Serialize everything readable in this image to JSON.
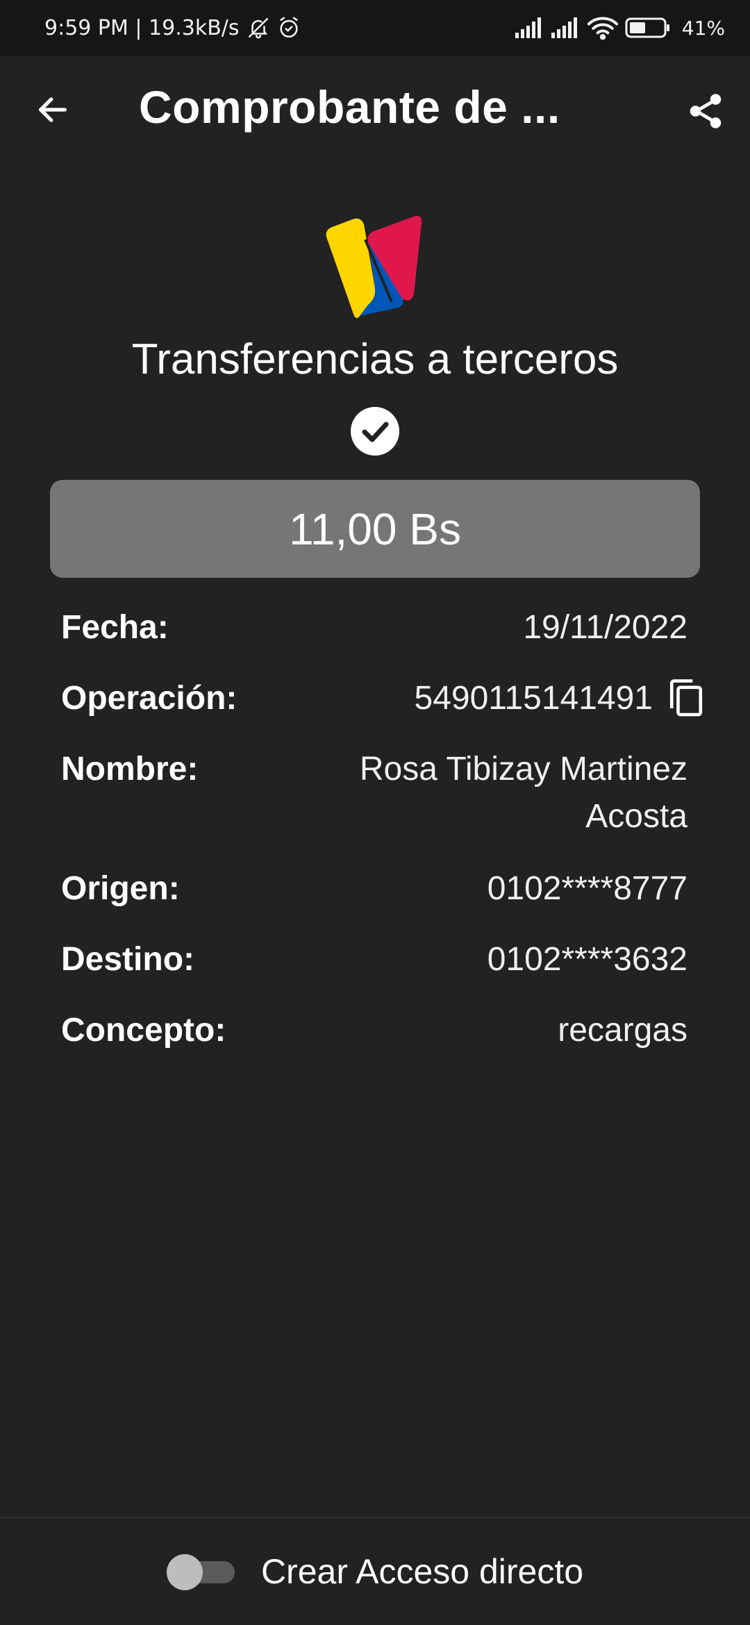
{
  "status_bar": {
    "time_speed": "9:59 PM | 19.3kB/s",
    "battery": "41%",
    "icons": [
      "bell-off-icon",
      "alarm-icon",
      "signal-icon",
      "signal-icon",
      "wifi-icon",
      "battery-icon"
    ]
  },
  "app_bar": {
    "title": "Comprobante de ...",
    "back_icon": "arrow-left-icon",
    "share_icon": "share-icon"
  },
  "receipt": {
    "logo": "bank-logo",
    "title": "Transferencias a terceros",
    "status_icon": "check-circle-icon",
    "amount": "11,00 Bs"
  },
  "details": {
    "fecha": {
      "label": "Fecha:",
      "value": "19/11/2022"
    },
    "operacion": {
      "label": "Operación:",
      "value": "5490115141491",
      "icon": "copy-icon"
    },
    "nombre": {
      "label": "Nombre:",
      "value": "Rosa Tibizay Martinez Acosta"
    },
    "origen": {
      "label": "Origen:",
      "value": "0102****8777"
    },
    "destino": {
      "label": "Destino:",
      "value": "0102****3632"
    },
    "concepto": {
      "label": "Concepto:",
      "value": "recargas"
    }
  },
  "footer": {
    "toggle_label": "Crear Acceso directo",
    "toggle_on": false
  },
  "colors": {
    "background": "#222223",
    "status_bar": "#161617",
    "amount_box": "#767676",
    "logo_yellow": "#FFD500",
    "logo_blue": "#0057B8",
    "logo_red": "#E0174D"
  }
}
